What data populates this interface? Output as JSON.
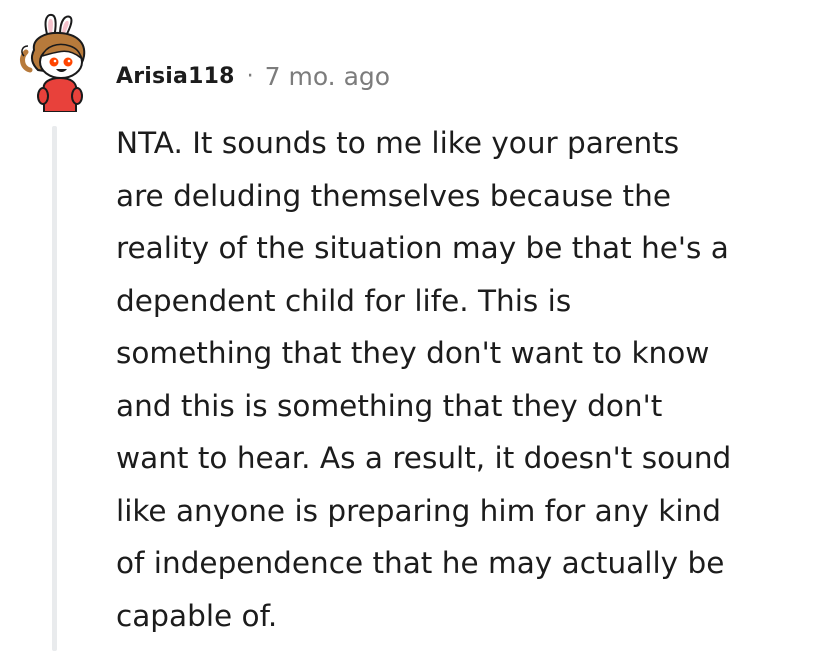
{
  "comment": {
    "author": "Arisia118",
    "separator": "·",
    "timestamp": "7 mo. ago",
    "body_lines": [
      "NTA. It sounds to me like your parents",
      "are deluding themselves because the",
      "reality of the situation may be that he's a",
      "dependent child for life. This is",
      "something that they don't want to know",
      "and this is something that they don't",
      "want to hear. As a result, it doesn't sound",
      "like anyone is preparing him for any kind",
      "of independence that he may actually be",
      "capable of."
    ]
  },
  "avatar": {
    "icon": "snoo-avatar-bunny-ears",
    "shirt_color": "#e8413b",
    "hair_color": "#b77a3b",
    "eye_color": "#ff4500"
  },
  "colors": {
    "text": "#1c1c1c",
    "meta": "#7c7c7c",
    "thread_line": "#e9ebed"
  }
}
